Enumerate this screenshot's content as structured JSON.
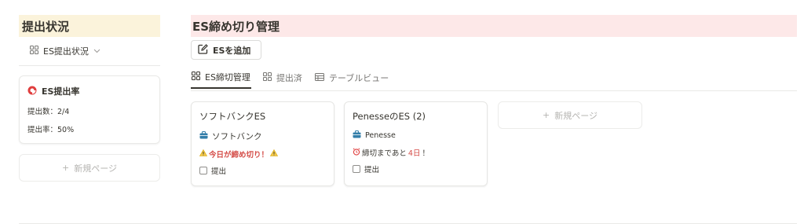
{
  "left": {
    "title": "提出状況",
    "view_label": "ES提出状況",
    "stat_card": {
      "title": "ES提出率",
      "count_line": "提出数：2/4",
      "rate_line": "提出率：50%",
      "rate_fraction": 0.5
    },
    "new_page": "新規ページ"
  },
  "main": {
    "title": "ES締め切り管理",
    "add_button": "ESを追加",
    "tabs": [
      {
        "label": "ES締切管理",
        "icon": "board-icon",
        "active": true
      },
      {
        "label": "提出済",
        "icon": "board-icon",
        "active": false
      },
      {
        "label": "テーブルビュー",
        "icon": "table-icon",
        "active": false
      }
    ],
    "cards": [
      {
        "title": "ソフトバンクES",
        "company": "ソフトバンク",
        "warning": "今日が締め切り！",
        "check_label": "提出",
        "checked": false
      },
      {
        "title": "PenesseのES (2)",
        "company": "Penesse",
        "warning_prefix": "締切まであと",
        "warning_days": "4日",
        "warning_suffix": "！",
        "check_label": "提出",
        "checked": false
      }
    ],
    "new_page": "新規ページ"
  },
  "colors": {
    "left_title_bg": "#fbf3db",
    "main_title_bg": "#fde8e8",
    "alert_red": "#d44c47",
    "briefcase_blue": "#337ea9"
  }
}
